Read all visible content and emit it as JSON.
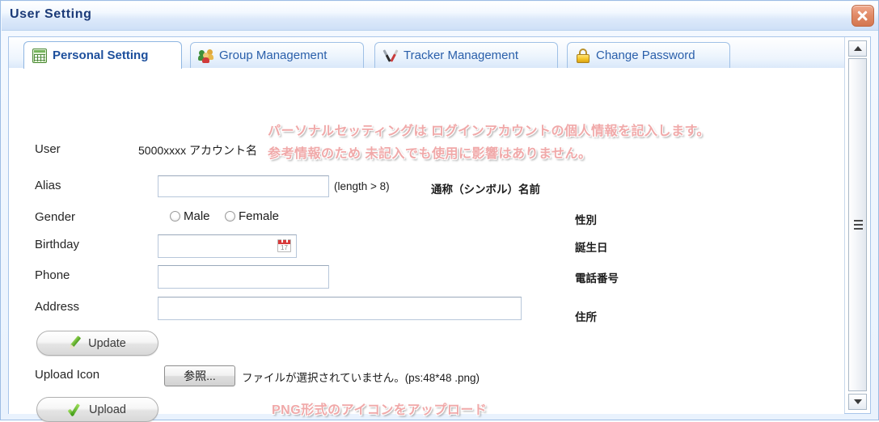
{
  "window": {
    "title": "User Setting",
    "close_icon": "close-icon"
  },
  "tabs": [
    {
      "label": "Personal Setting",
      "icon": "grid-icon",
      "active": true
    },
    {
      "label": "Group Management",
      "icon": "users-icon",
      "active": false
    },
    {
      "label": "Tracker Management",
      "icon": "tools-icon",
      "active": false
    },
    {
      "label": "Change Password",
      "icon": "lock-icon",
      "active": false
    }
  ],
  "form": {
    "user": {
      "label": "User",
      "value": "5000xxxx アカウント名"
    },
    "alias": {
      "label": "Alias",
      "value": "",
      "placeholder": "",
      "hint": "(length > 8)",
      "jp": "通称（シンボル）名前"
    },
    "gender": {
      "label": "Gender",
      "options": [
        "Male",
        "Female"
      ],
      "selected": "",
      "jp": "性別"
    },
    "birthday": {
      "label": "Birthday",
      "value": "",
      "placeholder": "",
      "jp": "誕生日",
      "calendar_icon": "calendar-icon",
      "calendar_day": "17"
    },
    "phone": {
      "label": "Phone",
      "value": "",
      "placeholder": "",
      "jp": "電話番号"
    },
    "address": {
      "label": "Address",
      "value": "",
      "placeholder": "",
      "jp": "住所"
    },
    "update_button": {
      "label": "Update",
      "icon": "pencil-icon"
    },
    "upload_icon_row": {
      "label": "Upload Icon",
      "browse_button": "参照...",
      "file_status": "ファイルが選択されていません。(ps:48*48 .png)"
    },
    "upload_button": {
      "label": "Upload",
      "icon": "check-icon"
    }
  },
  "annotations": [
    "パーソナルセッティングは  ログインアカウントの個人情報を記入します。",
    "参考情報のため  未記入でも使用に影響はありません。",
    "PNG形式のアイコンをアップロード"
  ],
  "scrollbar": {
    "up_icon": "triangle-up-icon",
    "down_icon": "triangle-down-icon"
  },
  "colors": {
    "title_text": "#1b3a78",
    "tab_text": "#2a5faa",
    "annotation": "#f0a9a9",
    "close_button": "#d4764f"
  }
}
